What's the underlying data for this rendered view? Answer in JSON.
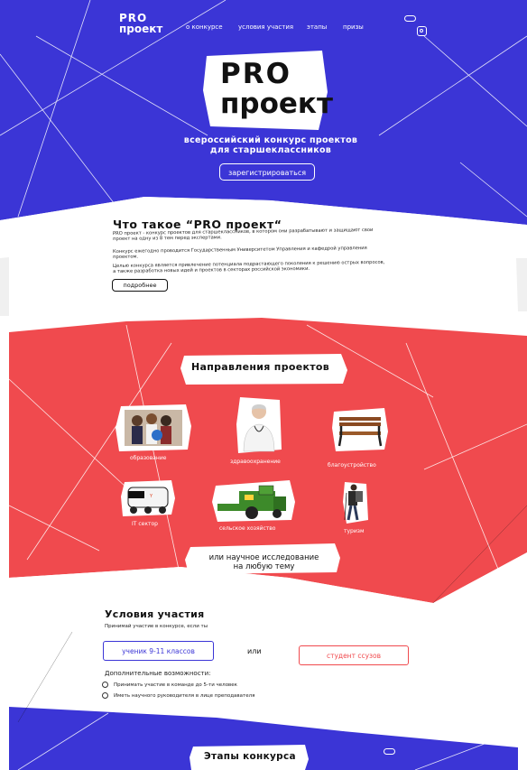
{
  "nav": {
    "logo_line1": "PRO",
    "logo_line2": "проект",
    "items": [
      "о конкурсе",
      "условия участия",
      "этапы",
      "призы"
    ]
  },
  "hero": {
    "logo_line1": "PRO",
    "logo_line2": "проект",
    "subtitle_line1": "всероссийский конкурс проектов",
    "subtitle_line2": "для старшеклассников",
    "register_label": "зарегистрироваться"
  },
  "about": {
    "title": "Что такое “PRO проект“",
    "p1_line1": "PRO проект - конкурс проектов для старшеклассников, в котором они разрабатывают и защищают свои",
    "p1_line2": "проект на одну из 8 тем перед экспертами.",
    "p2_line1": "Конкурс ежегодно проводится Государственным Университетом Управления и кафедрой управления",
    "p2_line2": "проектом.",
    "p3_line1": "Целью конкурса является привлечение потенциала подрастающего поколения к решению острых вопросов,",
    "p3_line2": "а также разработка новых идей и проектов в секторах российской экономики.",
    "more_label": "подробнее"
  },
  "directions": {
    "title": "Направления проектов",
    "items": [
      "образование",
      "здравоохранение",
      "благоустройство",
      "IT сектор",
      "сельское хозяйство",
      "туризм"
    ],
    "research_line1": "или научное исследование",
    "research_line2": "на любую тему"
  },
  "conditions": {
    "title": "Условия участия",
    "subtitle": "Принимай участие в конкурсе, если ты",
    "option_a": "ученик 9-11 классов",
    "or_label": "или",
    "option_b": "студент ссузов",
    "extra_title": "Дополнительные возможности:",
    "extra_items": [
      "Принимать участие в команде до 5-ти человек",
      "Иметь научного руководителя в лице преподавателя"
    ]
  },
  "stages": {
    "title": "Этапы конкурса"
  },
  "colors": {
    "blue": "#3B35D6",
    "red": "#F04A4E",
    "white": "#FFFFFF",
    "dark": "#111111"
  }
}
